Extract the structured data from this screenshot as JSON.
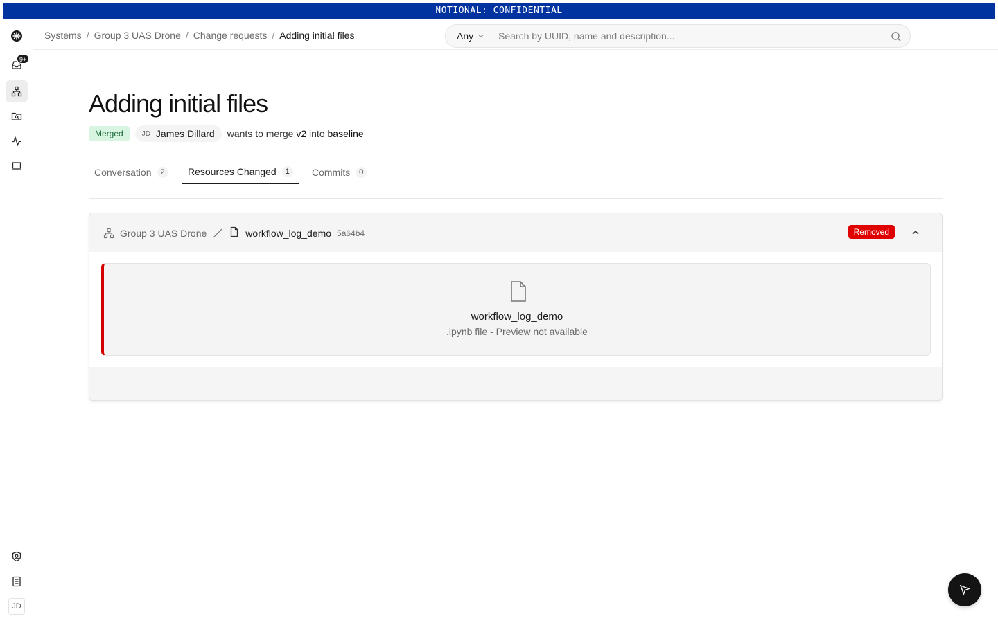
{
  "banner": {
    "text": "NOTIONAL: CONFIDENTIAL",
    "color": "#0033a0"
  },
  "sidebar": {
    "notifications_badge": "9+",
    "items": [
      {
        "icon": "logo-icon"
      },
      {
        "icon": "inbox-icon"
      },
      {
        "icon": "systems-icon",
        "active": true
      },
      {
        "icon": "folder-search-icon"
      },
      {
        "icon": "activity-icon"
      },
      {
        "icon": "laptop-icon"
      }
    ],
    "bottom": [
      {
        "icon": "shield-user-icon"
      },
      {
        "icon": "docs-icon"
      }
    ],
    "user_initials": "JD"
  },
  "breadcrumb": {
    "items": [
      "Systems",
      "Group 3 UAS Drone",
      "Change requests"
    ],
    "current": "Adding initial files"
  },
  "search": {
    "scope": "Any",
    "placeholder": "Search by UUID, name and description..."
  },
  "change_request": {
    "title": "Adding initial files",
    "status": "Merged",
    "author_initials": "JD",
    "author_name": "James Dillard",
    "desc_prefix": "wants to merge",
    "source_branch": "v2",
    "desc_mid": "into",
    "target_branch": "baseline"
  },
  "tabs": [
    {
      "label": "Conversation",
      "count": "2"
    },
    {
      "label": "Resources Changed",
      "count": "1",
      "active": true
    },
    {
      "label": "Commits",
      "count": "0"
    }
  ],
  "resource": {
    "system": "Group 3 UAS Drone",
    "file_name": "workflow_log_demo",
    "hash": "5a64b4",
    "status": "Removed",
    "status_color": "#e00000",
    "preview_name": "workflow_log_demo",
    "preview_note": ".ipynb file - Preview not available"
  }
}
